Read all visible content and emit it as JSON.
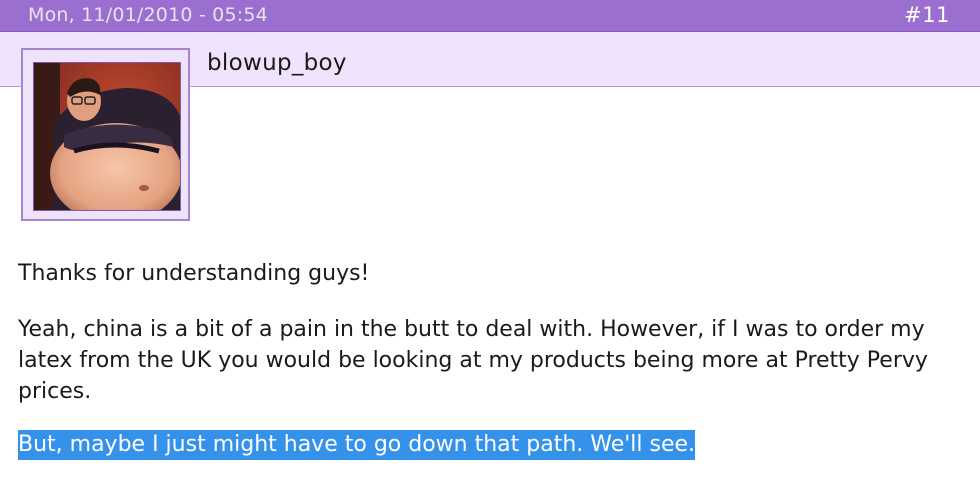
{
  "header": {
    "date": "Mon, 11/01/2010 - 05:54",
    "post_number": "#11"
  },
  "author": {
    "username": "blowup_boy",
    "avatar_icon": "user-avatar-photo"
  },
  "body": {
    "paragraphs": [
      "Thanks for understanding guys!",
      "Yeah, china is a bit of a pain in the butt to deal with. However, if I was to order my latex from the UK you would be looking at my products being more at Pretty Pervy prices.",
      "But, maybe I just might have to go down that path. We'll see."
    ],
    "selected_paragraph_index": 2
  },
  "colors": {
    "header_bg": "#9b6fcf",
    "author_bar_bg": "#efe3fb",
    "selection_bg": "#3592ea"
  }
}
